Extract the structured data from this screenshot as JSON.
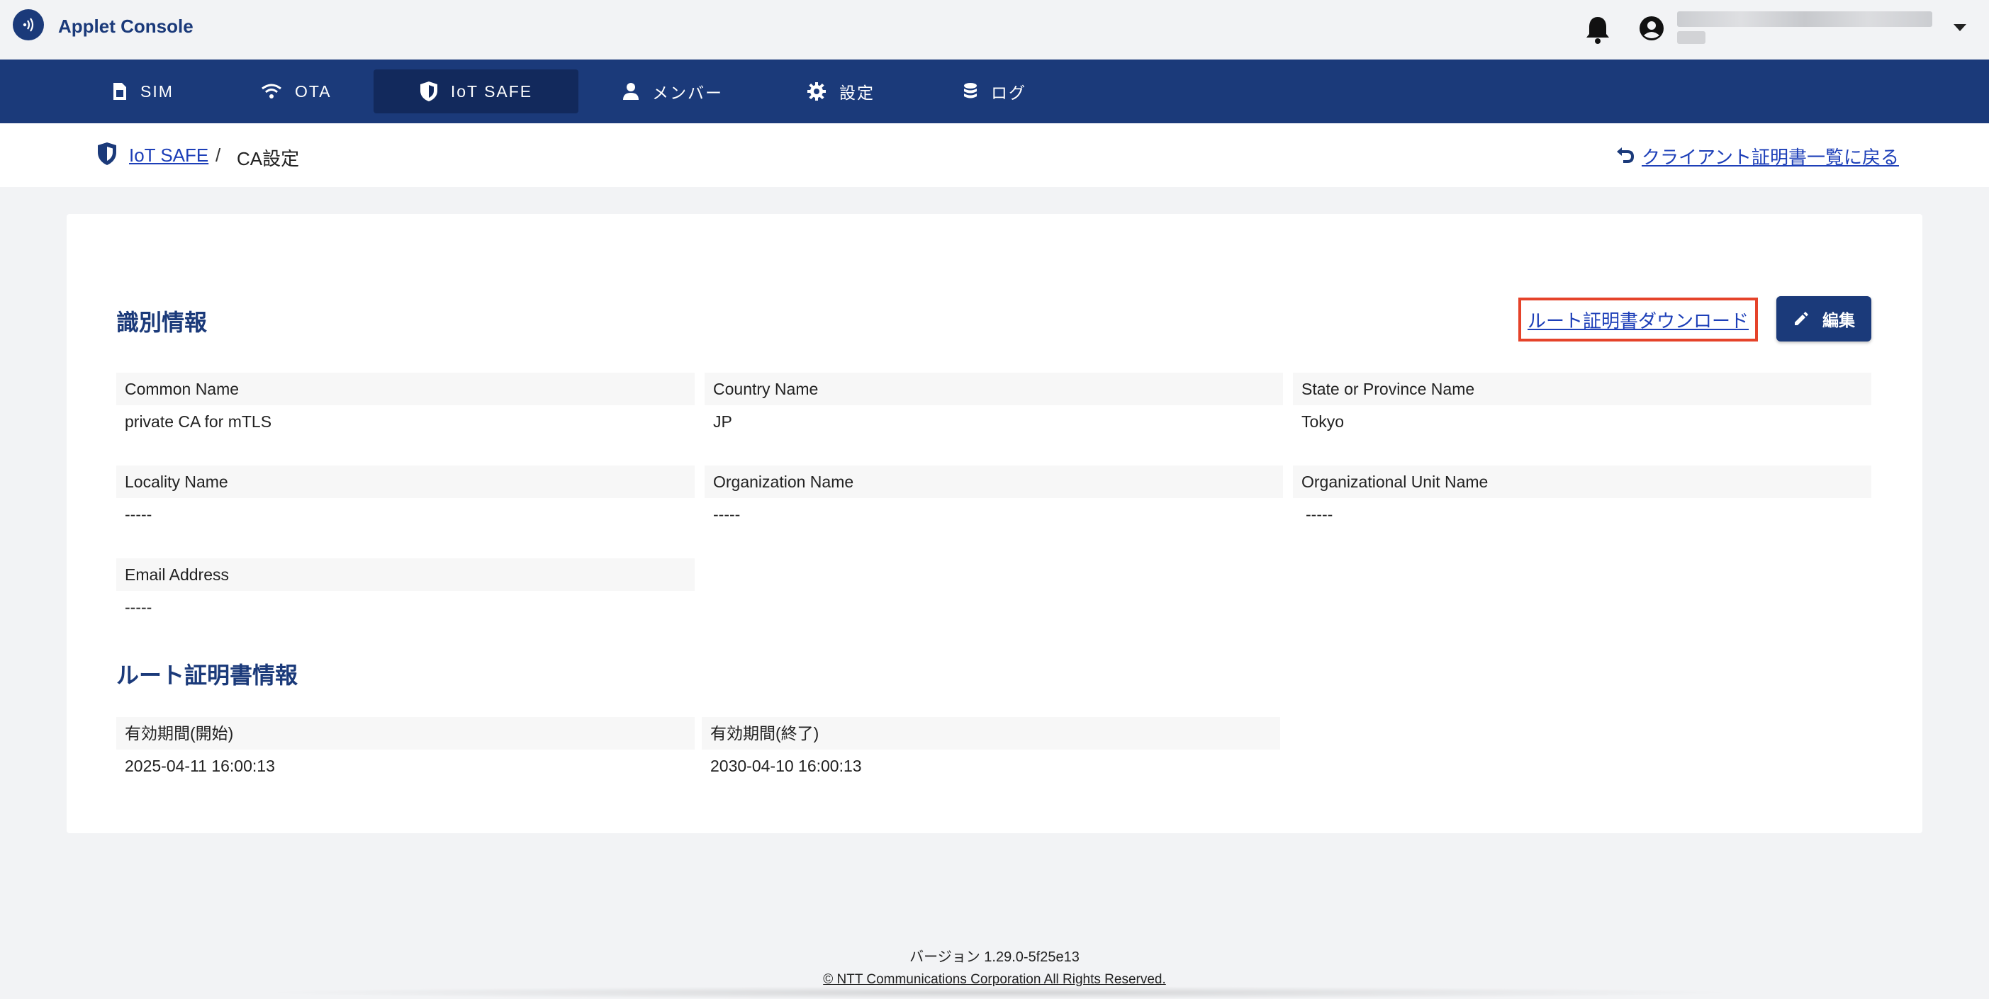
{
  "header": {
    "app_title": "Applet Console",
    "icons": [
      "wireless-logo-icon",
      "bell-icon",
      "account-icon",
      "chevron-down-icon"
    ]
  },
  "nav": {
    "items": [
      {
        "label": "SIM",
        "icon": "sim-card-icon"
      },
      {
        "label": "OTA",
        "icon": "wifi-icon"
      },
      {
        "label": "IoT SAFE",
        "icon": "shield-icon",
        "active": true
      },
      {
        "label": "メンバー",
        "icon": "person-icon"
      },
      {
        "label": "設定",
        "icon": "gear-icon"
      },
      {
        "label": "ログ",
        "icon": "database-icon"
      }
    ]
  },
  "breadcrumb": {
    "root": "IoT SAFE",
    "separator": "/",
    "current": "CA設定",
    "back_link": "クライアント証明書一覧に戻る"
  },
  "identity": {
    "title": "識別情報",
    "download_link": "ルート証明書ダウンロード",
    "edit_label": "編集",
    "fields": [
      {
        "label": "Common Name",
        "value": "private CA for mTLS"
      },
      {
        "label": "Country Name",
        "value": "JP"
      },
      {
        "label": "State or Province Name",
        "value": "Tokyo"
      },
      {
        "label": "Locality Name",
        "value": "-----"
      },
      {
        "label": "Organization Name",
        "value": "-----"
      },
      {
        "label": "Organizational Unit Name",
        "value": "-----"
      },
      {
        "label": "Email Address",
        "value": "-----"
      }
    ]
  },
  "root_cert": {
    "title": "ルート証明書情報",
    "fields": [
      {
        "label": "有効期間(開始)",
        "value": "2025-04-11 16:00:13"
      },
      {
        "label": "有効期間(終了)",
        "value": "2030-04-10 16:00:13"
      }
    ]
  },
  "footer": {
    "version": "バージョン 1.29.0-5f25e13",
    "copyright": "© NTT Communications Corporation All Rights Reserved."
  },
  "colors": {
    "brand": "#1b3a7a",
    "nav_active": "#12295c",
    "link": "#1d3fb8",
    "highlight": "#e5432a",
    "background": "#f2f3f5"
  }
}
